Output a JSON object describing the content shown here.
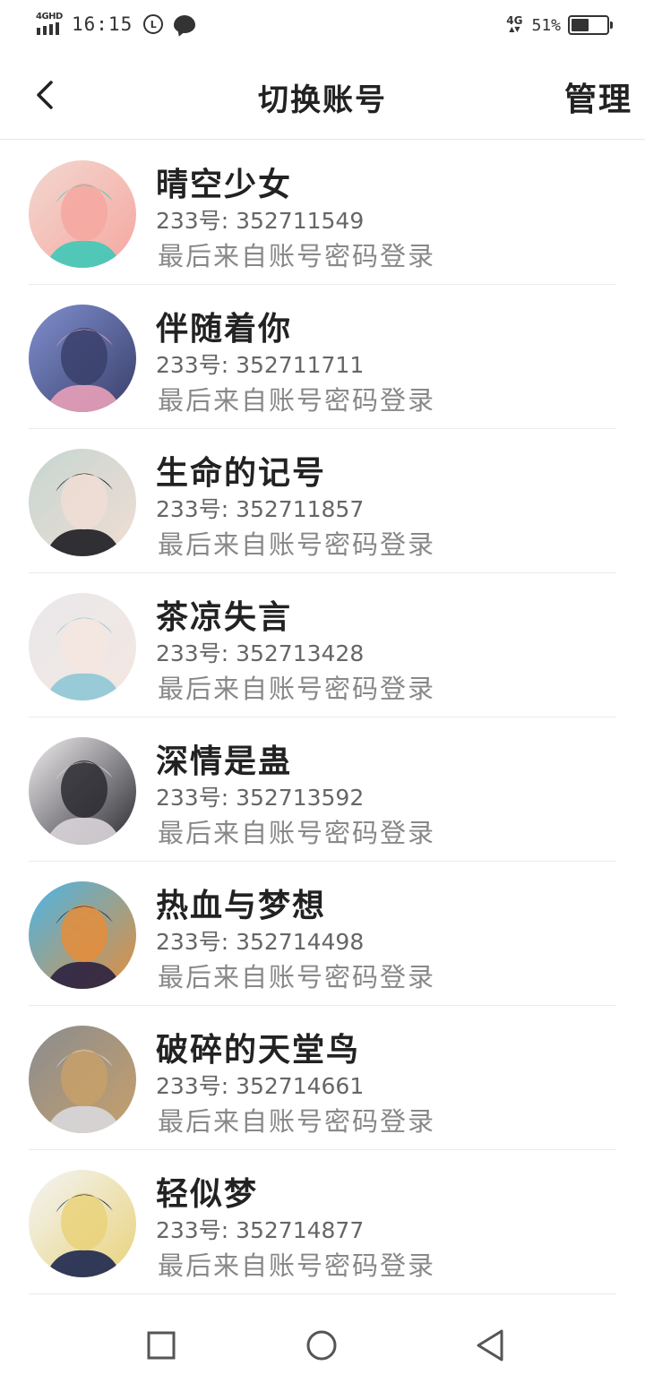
{
  "status_bar": {
    "network_label": "4GHD",
    "time": "16:15",
    "notification_badge": "L",
    "right_network": "4G",
    "battery_percent_text": "51%",
    "battery_level": 0.51
  },
  "header": {
    "title": "切换账号",
    "manage_label": "管理"
  },
  "accounts": [
    {
      "name": "晴空少女",
      "id_text": "233号: 352711549",
      "login_text": "最后来自账号密码登录",
      "avatar_colors": [
        "#f2d8d0",
        "#3fc9b8",
        "#f5a7a0"
      ]
    },
    {
      "name": "伴随着你",
      "id_text": "233号: 352711711",
      "login_text": "最后来自账号密码登录",
      "avatar_colors": [
        "#7f8fcf",
        "#e8a0b8",
        "#3a3f6a"
      ]
    },
    {
      "name": "生命的记号",
      "id_text": "233号: 352711857",
      "login_text": "最后来自账号密码登录",
      "avatar_colors": [
        "#c6d6d2",
        "#1c1c22",
        "#f0ddd3"
      ]
    },
    {
      "name": "茶凉失言",
      "id_text": "233号: 352713428",
      "login_text": "最后来自账号密码登录",
      "avatar_colors": [
        "#e9e9ec",
        "#8ec7d6",
        "#f4e6e0"
      ]
    },
    {
      "name": "深情是蛊",
      "id_text": "233号: 352713592",
      "login_text": "最后来自账号密码登录",
      "avatar_colors": [
        "#f1eef0",
        "#d9d4d8",
        "#2a2a30"
      ]
    },
    {
      "name": "热血与梦想",
      "id_text": "233号: 352714498",
      "login_text": "最后来自账号密码登录",
      "avatar_colors": [
        "#4ab6e8",
        "#2b2140",
        "#e58d3a"
      ]
    },
    {
      "name": "破碎的天堂鸟",
      "id_text": "233号: 352714661",
      "login_text": "最后来自账号密码登录",
      "avatar_colors": [
        "#8a8c90",
        "#d8d8dc",
        "#c7a06a"
      ]
    },
    {
      "name": "轻似梦",
      "id_text": "233号: 352714877",
      "login_text": "最后来自账号密码登录",
      "avatar_colors": [
        "#f3f5f7",
        "#1d2750",
        "#e9d27a"
      ]
    }
  ],
  "nav_bar": {
    "icons": [
      "recent-apps-icon",
      "home-icon",
      "back-triangle-icon"
    ]
  }
}
